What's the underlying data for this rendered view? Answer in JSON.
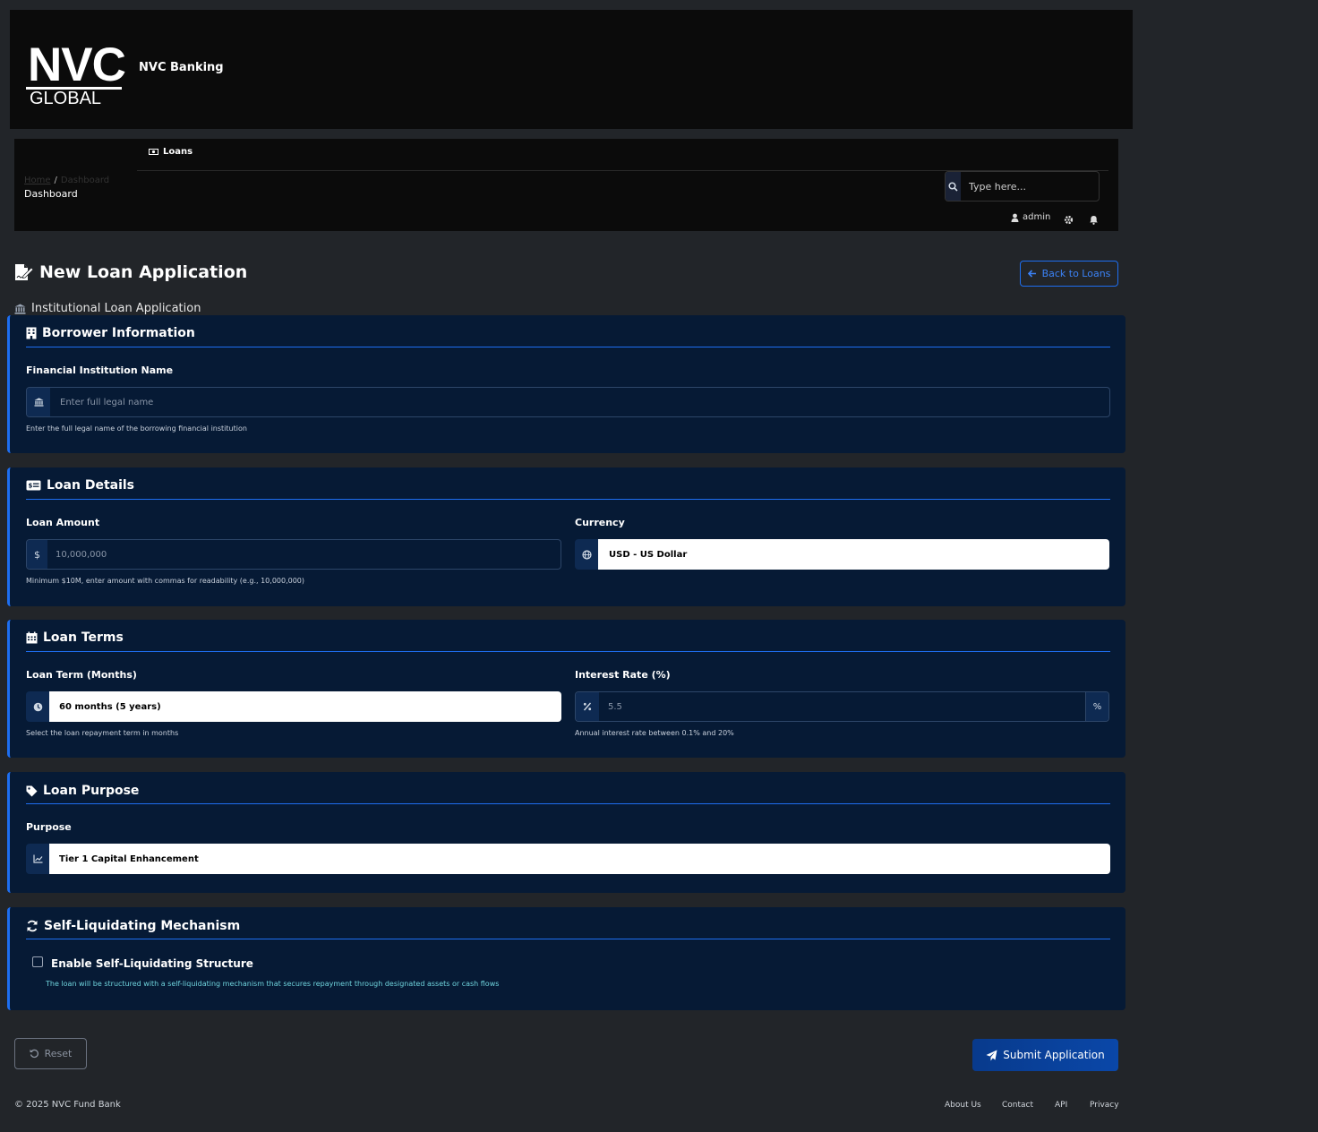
{
  "header": {
    "logo_main": "NVC",
    "logo_sub": "GLOBAL",
    "brand": "NVC Banking"
  },
  "nav": {
    "loans_label": "Loans",
    "breadcrumb_home": "Home",
    "breadcrumb_sep": "/",
    "breadcrumb_current": "Dashboard",
    "page_label": "Dashboard",
    "search_placeholder": "Type here...",
    "user": "admin"
  },
  "page": {
    "title": "New Loan Application",
    "back_label": "Back to Loans",
    "subtitle": "Institutional Loan Application"
  },
  "borrower": {
    "title": "Borrower Information",
    "institution_label": "Financial Institution Name",
    "institution_placeholder": "Enter full legal name",
    "institution_help": "Enter the full legal name of the borrowing financial institution"
  },
  "loan_details": {
    "title": "Loan Details",
    "amount_label": "Loan Amount",
    "amount_prefix": "$",
    "amount_placeholder": "10,000,000",
    "amount_help": "Minimum $10M, enter amount with commas for readability (e.g., 10,000,000)",
    "currency_label": "Currency",
    "currency_value": "USD - US Dollar"
  },
  "loan_terms": {
    "title": "Loan Terms",
    "term_label": "Loan Term (Months)",
    "term_value": "60 months (5 years)",
    "term_help": "Select the loan repayment term in months",
    "rate_label": "Interest Rate (%)",
    "rate_placeholder": "5.5",
    "rate_suffix": "%",
    "rate_help": "Annual interest rate between 0.1% and 20%"
  },
  "loan_purpose": {
    "title": "Loan Purpose",
    "purpose_label": "Purpose",
    "purpose_value": "Tier 1 Capital Enhancement"
  },
  "self_liquidating": {
    "title": "Self-Liquidating Mechanism",
    "checkbox_label": "Enable Self-Liquidating Structure",
    "checked": false,
    "help": "The loan will be structured with a self-liquidating mechanism that secures repayment through designated assets or cash flows"
  },
  "actions": {
    "reset_label": "Reset",
    "submit_label": "Submit Application"
  },
  "footer": {
    "copyright": "© 2025 NVC Fund Bank",
    "links": [
      "About Us",
      "Contact",
      "API",
      "Privacy"
    ]
  },
  "colors": {
    "accent": "#1e6ef0",
    "card_bg": "#061a35",
    "page_bg": "#222529"
  }
}
